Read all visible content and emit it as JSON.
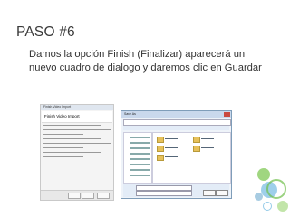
{
  "slide": {
    "title": "PASO #6",
    "bullet_symbol": "",
    "bullet_text": "Damos la opción Finish (Finalizar) aparecerá un nuevo cuadro de dialogo y daremos clic en Guardar"
  },
  "screenshot_finish_wizard": {
    "window_title": "Finish Video Import",
    "heading": "Finish Video Import"
  },
  "screenshot_save_dialog": {
    "window_title": "Save As"
  },
  "colors": {
    "accent_green": "#2f8f4a",
    "title_text": "#3a3a3a"
  }
}
